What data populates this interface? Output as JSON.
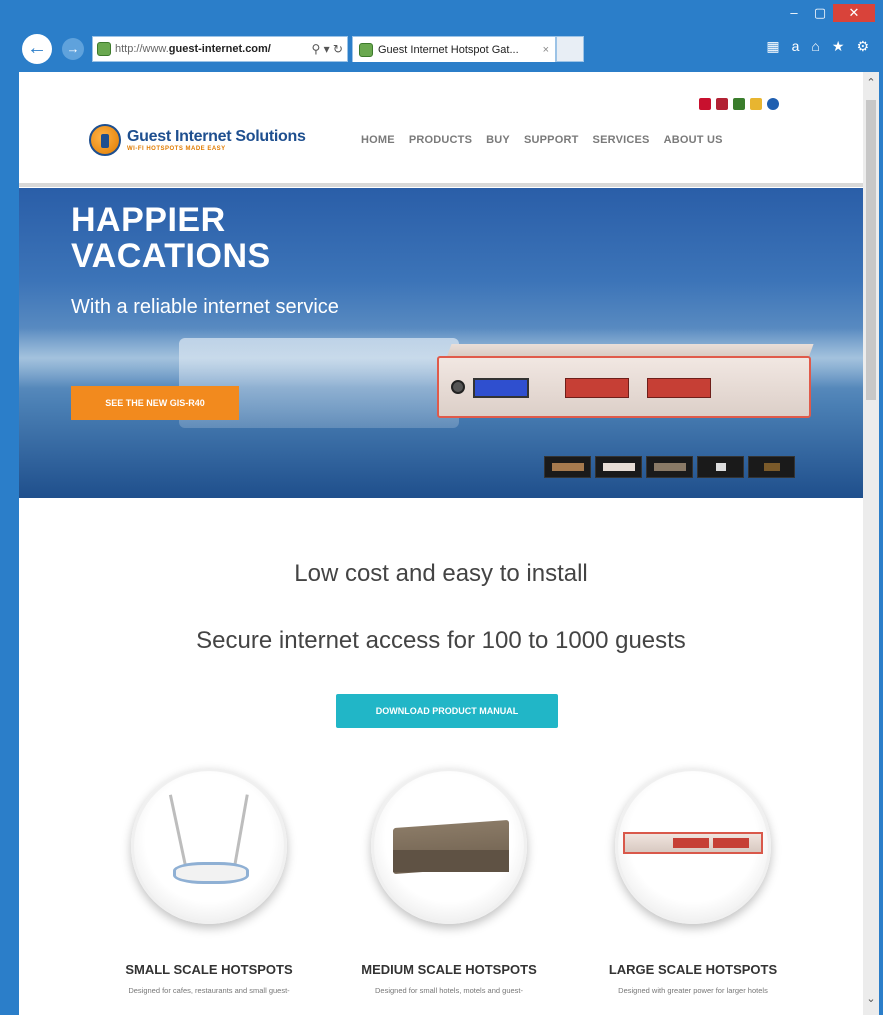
{
  "browser": {
    "url_prefix": "http://www.",
    "url_domain": "guest-internet.com/",
    "address_tools": "⚲ ▾ ↻",
    "tab_title": "Guest Internet Hotspot Gat...",
    "tab_close": "×",
    "window_controls": {
      "minimize": "–",
      "maximize": "▢",
      "close": "✕"
    },
    "back_glyph": "←",
    "forward_glyph": "→",
    "toolbar": [
      "▦",
      "a",
      "⌂",
      "★",
      "⚙"
    ],
    "scroll_up": "⌃",
    "scroll_down": "⌄"
  },
  "site": {
    "logo_name": "Guest Internet Solutions",
    "logo_tagline": "WI-FI HOTSPOTS MADE EASY",
    "nav": [
      "HOME",
      "PRODUCTS",
      "BUY",
      "SUPPORT",
      "SERVICES",
      "ABOUT US"
    ],
    "flag_colors": [
      "#c8102e",
      "#b22234",
      "#3a7d2c",
      "#e8b530",
      "#1f5fb0"
    ]
  },
  "hero": {
    "title_line1": "HAPPIER",
    "title_line2": "VACATIONS",
    "subtitle": "With a reliable internet service",
    "cta": "SEE THE NEW GIS-R40"
  },
  "content": {
    "lead1": "Low cost and easy to install",
    "lead2": "Secure internet access for 100 to 1000 guests",
    "download_button": "DOWNLOAD PRODUCT MANUAL"
  },
  "products": [
    {
      "title": "SMALL SCALE HOTSPOTS",
      "desc": "Designed for cafes, restaurants and small guest-"
    },
    {
      "title": "MEDIUM SCALE HOTSPOTS",
      "desc": "Designed for small hotels, motels and guest-"
    },
    {
      "title": "LARGE SCALE HOTSPOTS",
      "desc": "Designed with greater power for larger hotels"
    }
  ],
  "colors": {
    "brand_blue": "#1e4f8f",
    "brand_orange": "#f28a1e",
    "cta_teal": "#21b6c7",
    "chrome_blue": "#2b7ec9"
  }
}
